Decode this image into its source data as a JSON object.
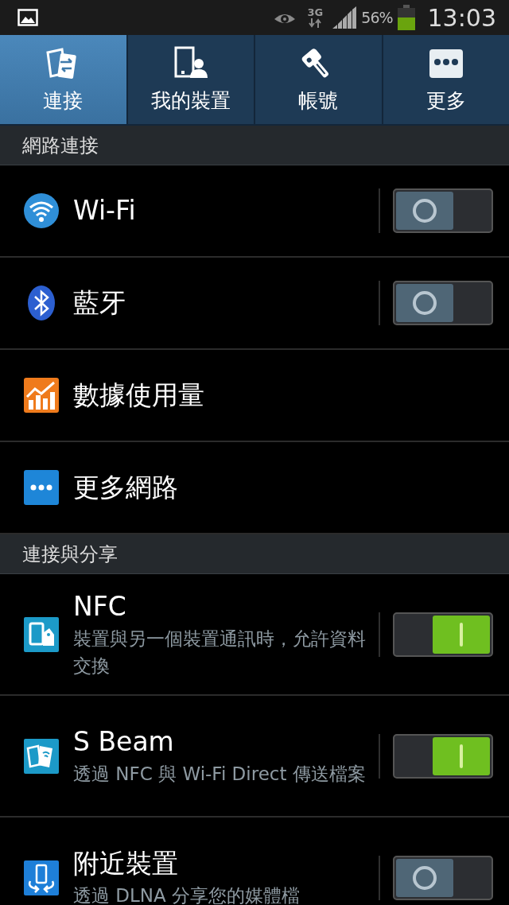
{
  "status_bar": {
    "network": "3G",
    "battery": "56%",
    "time": "13:03"
  },
  "tabs": [
    {
      "label": "連接",
      "selected": true
    },
    {
      "label": "我的裝置",
      "selected": false
    },
    {
      "label": "帳號",
      "selected": false
    },
    {
      "label": "更多",
      "selected": false
    }
  ],
  "sections": [
    {
      "header": "網路連接",
      "items": [
        {
          "kind": "switch",
          "title": "Wi-Fi",
          "on": false
        },
        {
          "kind": "switch",
          "title": "藍牙",
          "on": false
        },
        {
          "kind": "link",
          "title": "數據使用量"
        },
        {
          "kind": "link",
          "title": "更多網路"
        }
      ]
    },
    {
      "header": "連接與分享",
      "items": [
        {
          "kind": "switch",
          "title": "NFC",
          "subtitle": "裝置與另一個裝置通訊時，允許資料交換",
          "on": true
        },
        {
          "kind": "switch",
          "title": "S Beam",
          "subtitle": "透過 NFC 與 Wi-Fi Direct 傳送檔案",
          "on": true
        },
        {
          "kind": "switch",
          "title": "附近裝置",
          "subtitle": "透過 DLNA 分享您的媒體檔",
          "on": false
        }
      ]
    }
  ]
}
